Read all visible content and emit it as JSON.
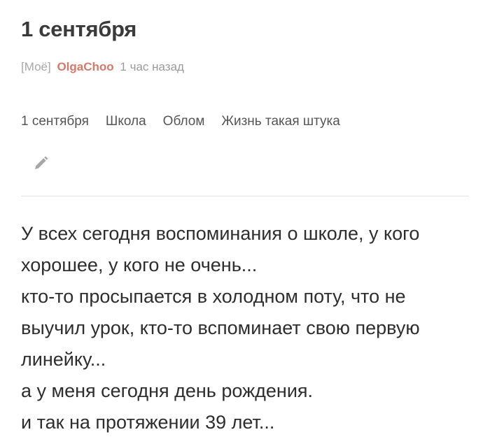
{
  "post": {
    "title": "1 сентября",
    "community": "[Моё]",
    "author": "OlgaChoo",
    "time": "1 час назад",
    "tags": [
      "1 сентября",
      "Школа",
      "Облом",
      "Жизнь такая штука"
    ],
    "edit_icon": "pencil-icon",
    "body": [
      "У всех сегодня воспоминания о школе, у кого хорошее, у кого не очень...",
      "кто-то просыпается в холодном поту, что не выучил урок, кто-то вспоминает свою первую линейку...",
      "а у меня сегодня день рождения.",
      "и так на протяжении 39 лет..."
    ]
  },
  "colors": {
    "author": "#d47a6a",
    "text": "#2e2e2e",
    "muted": "#9a9a9a",
    "divider": "#e3e3e3"
  }
}
